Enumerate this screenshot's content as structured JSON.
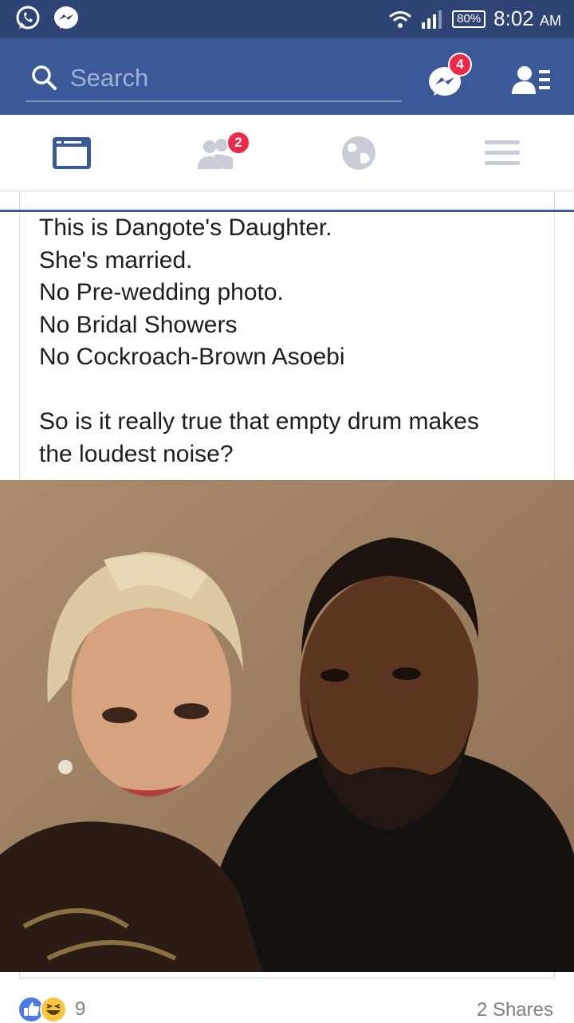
{
  "status_bar": {
    "battery": "80%",
    "time": "8:02",
    "ampm": "AM",
    "icons": [
      "whatsapp-icon",
      "messenger-icon",
      "wifi-icon",
      "signal-icon",
      "battery-icon"
    ]
  },
  "header": {
    "search_placeholder": "Search",
    "messenger_badge": "4",
    "icons": [
      "search-icon",
      "messenger-icon",
      "friend-list-icon"
    ]
  },
  "tabs": [
    {
      "name": "news-feed",
      "icon": "news-feed-icon",
      "active": true
    },
    {
      "name": "friend-requests",
      "icon": "friends-icon",
      "badge": "2"
    },
    {
      "name": "notifications",
      "icon": "globe-icon"
    },
    {
      "name": "menu",
      "icon": "hamburger-icon"
    }
  ],
  "post": {
    "lines": [
      "This is Dangote's Daughter.",
      "She's married.",
      "No Pre-wedding photo.",
      "No Bridal Showers",
      "No Cockroach-Brown Asoebi",
      "So is it really true that empty drum makes",
      "the loudest noise?"
    ],
    "reaction_icons": [
      "like-icon",
      "haha-icon"
    ],
    "reaction_count": "9",
    "shares": "2 Shares"
  },
  "colors": {
    "header": "#3b5998",
    "status_bar": "#2d4475",
    "badge": "#f02849"
  }
}
